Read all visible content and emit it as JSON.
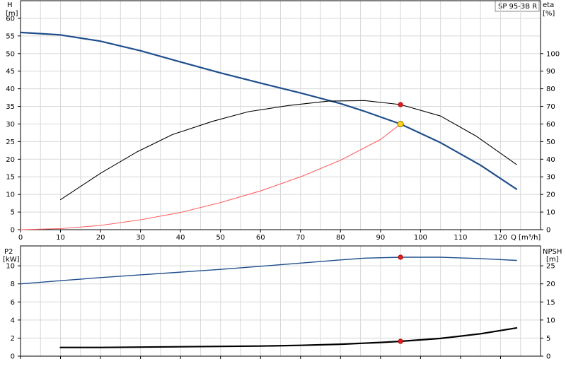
{
  "chart_data": [
    {
      "type": "line",
      "panel": "top",
      "model_label": "SP 95-3B R",
      "x_axis": {
        "label": "Q [m³/h]",
        "range": [
          0,
          130
        ],
        "ticks": [
          0,
          10,
          20,
          30,
          40,
          50,
          60,
          70,
          80,
          90,
          100,
          110,
          120
        ]
      },
      "y_left": {
        "label_line1": "H",
        "label_line2": "[m]",
        "range": [
          0,
          65
        ],
        "ticks": [
          0,
          5,
          10,
          15,
          20,
          25,
          30,
          35,
          40,
          45,
          50,
          55,
          60
        ]
      },
      "y_right": {
        "label_line1": "eta",
        "label_line2": "[%]",
        "range": [
          0,
          130
        ],
        "ticks": [
          0,
          10,
          20,
          30,
          40,
          50,
          60,
          70,
          80,
          90,
          100
        ]
      },
      "grid": true,
      "series": [
        {
          "key": "head",
          "axis": "left",
          "color": "#1f4e8c",
          "width": 2.2,
          "x": [
            0,
            10,
            20,
            30,
            40,
            50,
            60,
            70,
            80,
            86,
            95,
            105,
            115,
            124
          ],
          "y": [
            56,
            55.3,
            53.5,
            50.8,
            47.6,
            44.5,
            41.6,
            38.8,
            35.8,
            33.6,
            30,
            24.7,
            18.3,
            11.5
          ]
        },
        {
          "key": "efficiency",
          "axis": "right",
          "color": "#000000",
          "width": 1.1,
          "x": [
            10,
            20,
            29,
            38,
            48,
            57,
            67,
            77,
            86,
            95,
            105,
            114,
            124
          ],
          "y": [
            17,
            32,
            44,
            54,
            61.5,
            67,
            70.5,
            73,
            73.3,
            71,
            64.5,
            53,
            37
          ]
        },
        {
          "key": "system",
          "axis": "left",
          "color": "#ff6060",
          "width": 1.1,
          "x": [
            0,
            10,
            20,
            30,
            40,
            50,
            60,
            70,
            80,
            90,
            95
          ],
          "y": [
            0,
            0.3,
            1.2,
            2.8,
            4.9,
            7.7,
            11,
            15,
            19.7,
            25.6,
            30
          ]
        }
      ],
      "markers": [
        {
          "x": 95,
          "y": 35.5,
          "axis": "left",
          "fill": "#e21c1c",
          "stroke": "#a00000",
          "r": 3.2
        },
        {
          "x": 95,
          "y": 30,
          "axis": "left",
          "fill": "#ffd21f",
          "stroke": "#7a6200",
          "r": 4.2
        }
      ]
    },
    {
      "type": "line",
      "panel": "bottom",
      "x_axis": {
        "range": [
          0,
          130
        ]
      },
      "y_left": {
        "label_line1": "P2",
        "label_line2": "[kW]",
        "range": [
          0,
          12.2
        ],
        "ticks": [
          0,
          2,
          4,
          6,
          8,
          10
        ]
      },
      "y_right": {
        "label_line1": "NPSH",
        "label_line2": "[m]",
        "range": [
          0,
          30.5
        ],
        "ticks": [
          0,
          5,
          10,
          15,
          20,
          25
        ]
      },
      "grid": true,
      "series": [
        {
          "key": "power",
          "axis": "left",
          "color": "#1f4e8c",
          "width": 1.4,
          "x": [
            0,
            10,
            20,
            30,
            40,
            50,
            60,
            70,
            80,
            86,
            95,
            105,
            115,
            124
          ],
          "y": [
            8,
            8.35,
            8.7,
            9,
            9.3,
            9.6,
            9.95,
            10.3,
            10.65,
            10.85,
            10.95,
            10.95,
            10.8,
            10.6
          ]
        },
        {
          "key": "npsh",
          "axis": "right",
          "color": "#000000",
          "width": 2.2,
          "x": [
            10,
            20,
            30,
            40,
            50,
            60,
            70,
            80,
            90,
            95,
            105,
            115,
            124
          ],
          "y": [
            2.4,
            2.4,
            2.5,
            2.6,
            2.7,
            2.8,
            3,
            3.3,
            3.8,
            4.1,
            4.9,
            6.2,
            7.8
          ]
        }
      ],
      "markers": [
        {
          "x": 95,
          "y": 10.95,
          "axis": "left",
          "fill": "#e21c1c",
          "stroke": "#a00000",
          "r": 3.2
        },
        {
          "x": 95,
          "y": 4.1,
          "axis": "right",
          "fill": "#e21c1c",
          "stroke": "#a00000",
          "r": 3.2
        }
      ]
    }
  ]
}
